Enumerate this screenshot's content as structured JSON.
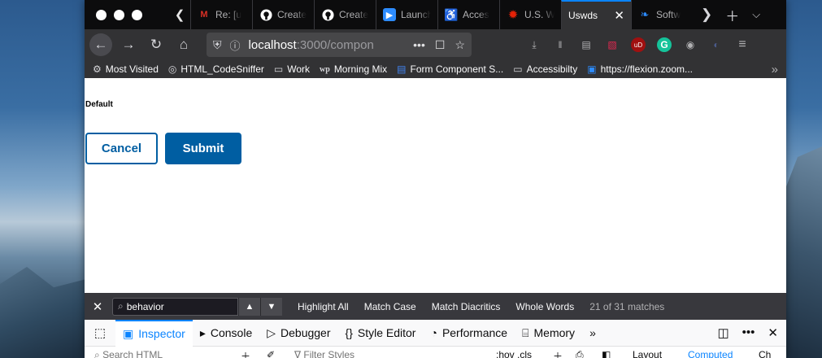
{
  "browser": {
    "tabs": [
      {
        "label": "Re: [u",
        "icon": "gmail-icon",
        "icon_color": "#d93025"
      },
      {
        "label": "Create",
        "icon": "github-icon",
        "icon_color": "#ffffff"
      },
      {
        "label": "Create",
        "icon": "github-icon",
        "icon_color": "#ffffff"
      },
      {
        "label": "Launch",
        "icon": "zoom-icon",
        "icon_color": "#2d8cff"
      },
      {
        "label": "Acces",
        "icon": "accessibility-icon",
        "icon_color": "#3d6fd6"
      },
      {
        "label": "U.S. W",
        "icon": "uswds-star-icon",
        "icon_color": "#e52207"
      },
      {
        "label": "Uswds",
        "active": true
      },
      {
        "label": "Softw",
        "icon": "flexion-icon",
        "icon_color": "#2d8cff"
      }
    ],
    "url_host": "localhost",
    "url_path": ":3000/compon",
    "bookmarks": [
      {
        "label": "Most Visited",
        "icon": "gear-icon"
      },
      {
        "label": "HTML_CodeSniffer",
        "icon": "globe-icon"
      },
      {
        "label": "Work",
        "icon": "folder-icon"
      },
      {
        "label": "Morning Mix",
        "icon": "wp-icon"
      },
      {
        "label": "Form Component S...",
        "icon": "docs-icon"
      },
      {
        "label": "Accessibilty",
        "icon": "folder-icon"
      },
      {
        "label": "https://flexion.zoom...",
        "icon": "zoom-icon"
      }
    ]
  },
  "page": {
    "section_label": "Default",
    "cancel_label": "Cancel",
    "submit_label": "Submit",
    "colors": {
      "primary": "#005ea2"
    }
  },
  "findbar": {
    "query": "behavior",
    "options": [
      "Highlight All",
      "Match Case",
      "Match Diacritics",
      "Whole Words"
    ],
    "match_count": "21 of 31 matches"
  },
  "devtools": {
    "tabs": [
      {
        "label": "Inspector",
        "icon": "inspector-icon",
        "active": true
      },
      {
        "label": "Console",
        "icon": "console-icon"
      },
      {
        "label": "Debugger",
        "icon": "debugger-icon"
      },
      {
        "label": "Style Editor",
        "icon": "style-editor-icon"
      },
      {
        "label": "Performance",
        "icon": "performance-icon"
      },
      {
        "label": "Memory",
        "icon": "memory-icon"
      }
    ],
    "sub": {
      "search_placeholder": "Search HTML",
      "filter_placeholder": "Filter Styles",
      "hov_cls": ":hov  .cls",
      "layout": "Layout",
      "computed": "Computed",
      "changes": "Ch"
    }
  }
}
